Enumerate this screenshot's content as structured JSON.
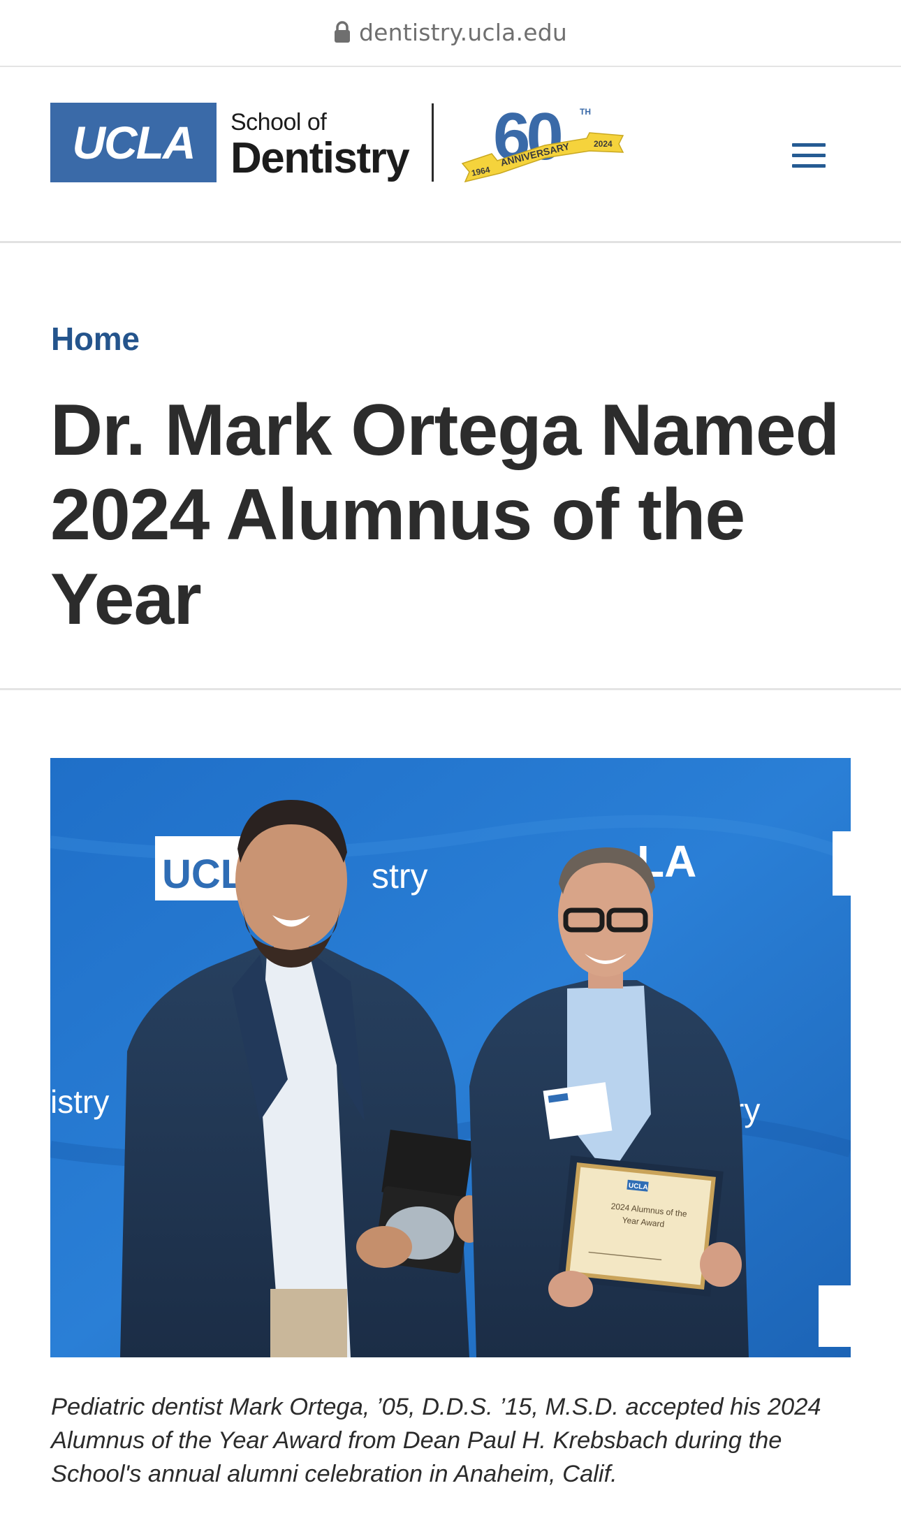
{
  "browser": {
    "url": "dentistry.ucla.edu",
    "lock_icon": "lock-icon"
  },
  "header": {
    "ucla_wordmark": "UCLA",
    "school_of": "School of",
    "school_name": "Dentistry",
    "anniversary": {
      "number": "60",
      "suffix": "TH",
      "banner_text": "ANNIVERSARY",
      "start_year": "1964",
      "end_year": "2024"
    },
    "menu_icon": "hamburger-menu-icon",
    "brand_color": "#3a6aa8",
    "accent_color": "#f5d33c"
  },
  "breadcrumb": {
    "home_label": "Home"
  },
  "article": {
    "title": "Dr. Mark Ortega Named 2024 Alumnus of the Year",
    "photo_caption": "Pediatric dentist Mark Ortega, ’05, D.D.S. ’15, M.S.D. accepted his 2024 Alumnus of the Year Award from Dean Paul H. Krebsbach during the School's annual alumni celebration in Anaheim, Calif."
  },
  "photo": {
    "backdrop_left_logo": "UCLA",
    "backdrop_left_text": "stry",
    "backdrop_right_logo": "LA",
    "backdrop_side_left": "istry",
    "backdrop_side_right": "ry",
    "plaque_logo": "UCLA",
    "plaque_line1": "2024 Alumnus of the",
    "plaque_line2": "Year Award"
  }
}
